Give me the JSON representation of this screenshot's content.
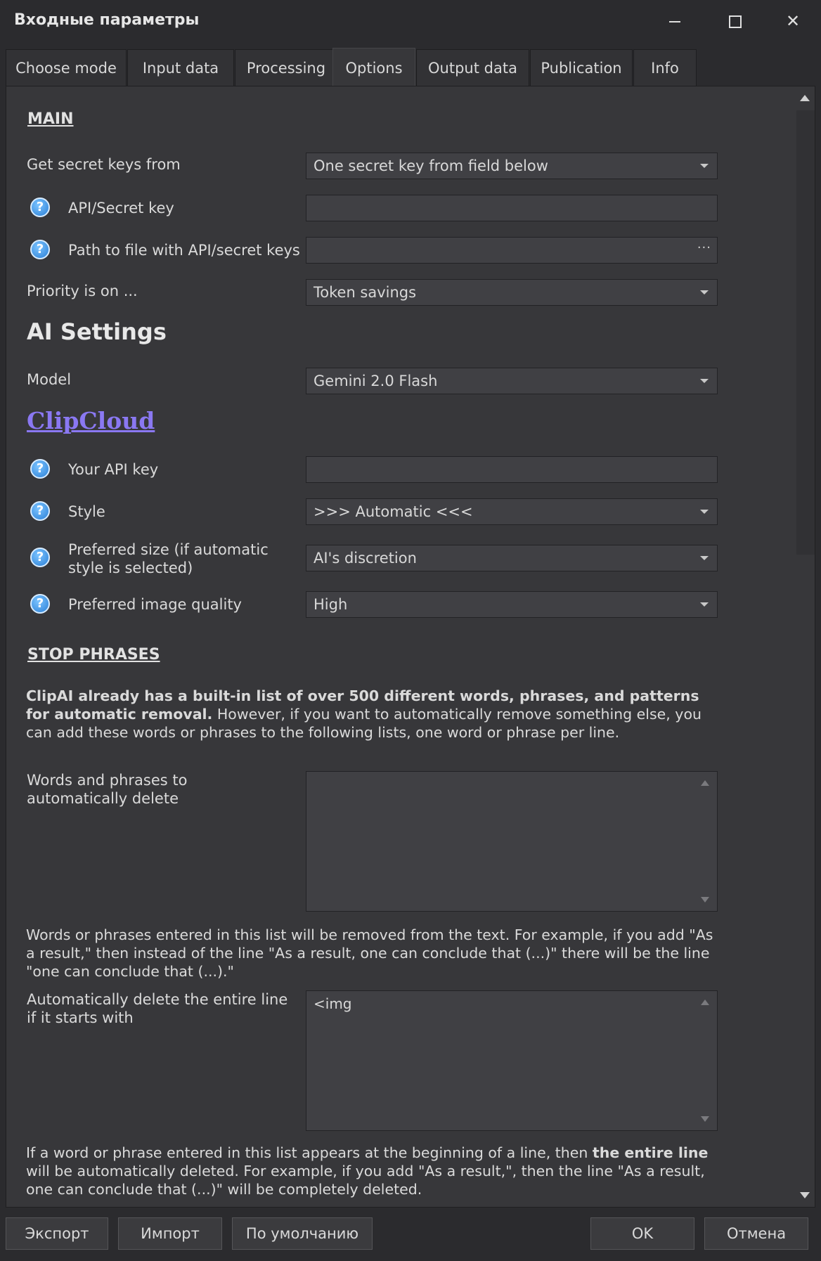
{
  "window": {
    "title": "Входные параметры",
    "controls": {
      "minimize": "minimize-icon",
      "maximize": "maximize-icon",
      "close": "close-icon"
    }
  },
  "tabs": [
    {
      "label": "Choose mode"
    },
    {
      "label": "Input data"
    },
    {
      "label": "Processing"
    },
    {
      "label": "Options",
      "active": true
    },
    {
      "label": "Output data"
    },
    {
      "label": "Publication"
    },
    {
      "label": "Info"
    }
  ],
  "main": {
    "section_title": "MAIN",
    "secret_keys_label": "Get secret keys from",
    "secret_keys_value": "One secret key from field below",
    "api_key_label": "API/Secret key",
    "api_key_value": "",
    "path_label": "Path to file with API/secret keys",
    "path_value": "",
    "path_button": "···",
    "priority_label": "Priority is on ...",
    "priority_value": "Token savings"
  },
  "ai": {
    "title": "AI Settings",
    "model_label": "Model",
    "model_value": "Gemini 2.0 Flash"
  },
  "clipcloud": {
    "link": "ClipCloud",
    "api_key_label": "Your API key",
    "api_key_value": "",
    "style_label": "Style",
    "style_value": ">>> Automatic <<<",
    "size_label": "Preferred size (if automatic style is selected)",
    "size_value": "AI's discretion",
    "quality_label": "Preferred image quality",
    "quality_value": "High"
  },
  "stop_phrases": {
    "title": "STOP PHRASES",
    "intro_bold": "ClipAI already has a built-in list of over 500 different words, phrases, and patterns for automatic removal.",
    "intro_rest": " However, if you want to automatically remove something else, you can add these words or phrases to the following lists, one word or phrase per line.",
    "delete_words_label": "Words and phrases to automatically delete",
    "delete_words_value": "",
    "delete_words_note": "Words or phrases entered in this list will be removed from the text. For example, if you add \"As a result,\" then instead of the line \"As a result, one can conclude that (...)\" there will be the line \"one can conclude that (...).\"",
    "delete_line_label": "Automatically delete the entire line if it starts with",
    "delete_line_value": "<img",
    "delete_line_note_a": "If a word or phrase entered in this list appears at the beginning of a line, then ",
    "delete_line_note_bold": "the entire line",
    "delete_line_note_b": " will be automatically deleted. For example, if you add \"As a result,\", then the line \"As a result, one can conclude that (...)\" will be completely deleted."
  },
  "footer": {
    "export": "Экспорт",
    "import": "Импорт",
    "defaults": "По умолчанию",
    "ok": "OK",
    "cancel": "Отмена"
  },
  "colors": {
    "background": "#2b2b2e",
    "panel": "#37373a",
    "field": "#404044",
    "link": "#8a78f2",
    "help": "#2a7fd6"
  }
}
